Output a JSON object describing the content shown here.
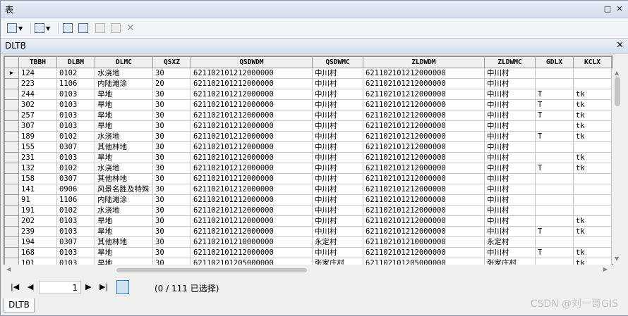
{
  "window": {
    "title": "表"
  },
  "table_name": "DLTB",
  "columns": [
    "TBBH",
    "DLBM",
    "DLMC",
    "QSXZ",
    "QSDWDM",
    "QSDWMC",
    "ZLDWDM",
    "ZLDWMC",
    "GDLX",
    "KCLX"
  ],
  "rows": [
    [
      "124",
      "0102",
      "水浇地",
      "30",
      "621102101212000000",
      "中川村",
      "621102101212000000",
      "中川村",
      "",
      ""
    ],
    [
      "223",
      "1106",
      "内陆滩涂",
      "20",
      "621102101212000000",
      "中川村",
      "621102101212000000",
      "中川村",
      "",
      ""
    ],
    [
      "244",
      "0103",
      "旱地",
      "30",
      "621102101212000000",
      "中川村",
      "621102101212000000",
      "中川村",
      "T",
      "tk"
    ],
    [
      "302",
      "0103",
      "旱地",
      "30",
      "621102101212000000",
      "中川村",
      "621102101212000000",
      "中川村",
      "T",
      "tk"
    ],
    [
      "257",
      "0103",
      "旱地",
      "30",
      "621102101212000000",
      "中川村",
      "621102101212000000",
      "中川村",
      "T",
      "tk"
    ],
    [
      "307",
      "0103",
      "旱地",
      "30",
      "621102101212000000",
      "中川村",
      "621102101212000000",
      "中川村",
      "",
      "tk"
    ],
    [
      "189",
      "0102",
      "水浇地",
      "30",
      "621102101212000000",
      "中川村",
      "621102101212000000",
      "中川村",
      "T",
      "tk"
    ],
    [
      "155",
      "0307",
      "其他林地",
      "30",
      "621102101212000000",
      "中川村",
      "621102101212000000",
      "中川村",
      "",
      ""
    ],
    [
      "231",
      "0103",
      "旱地",
      "30",
      "621102101212000000",
      "中川村",
      "621102101212000000",
      "中川村",
      "",
      "tk"
    ],
    [
      "132",
      "0102",
      "水浇地",
      "30",
      "621102101212000000",
      "中川村",
      "621102101212000000",
      "中川村",
      "T",
      "tk"
    ],
    [
      "158",
      "0307",
      "其他林地",
      "30",
      "621102101212000000",
      "中川村",
      "621102101212000000",
      "中川村",
      "",
      ""
    ],
    [
      "141",
      "0906",
      "风景名胜及特殊",
      "30",
      "621102101212000000",
      "中川村",
      "621102101212000000",
      "中川村",
      "",
      ""
    ],
    [
      "91",
      "1106",
      "内陆滩涂",
      "30",
      "621102101212000000",
      "中川村",
      "621102101212000000",
      "中川村",
      "",
      ""
    ],
    [
      "191",
      "0102",
      "水浇地",
      "30",
      "621102101212000000",
      "中川村",
      "621102101212000000",
      "中川村",
      "",
      ""
    ],
    [
      "202",
      "0103",
      "旱地",
      "30",
      "621102101212000000",
      "中川村",
      "621102101212000000",
      "中川村",
      "",
      "tk"
    ],
    [
      "239",
      "0103",
      "旱地",
      "30",
      "621102101212000000",
      "中川村",
      "621102101212000000",
      "中川村",
      "T",
      "tk"
    ],
    [
      "194",
      "0307",
      "其他林地",
      "30",
      "621102101210000000",
      "永定村",
      "621102101210000000",
      "永定村",
      "",
      ""
    ],
    [
      "168",
      "0103",
      "旱地",
      "30",
      "621102101212000000",
      "中川村",
      "621102101212000000",
      "中川村",
      "T",
      "tk"
    ],
    [
      "101",
      "0103",
      "旱地",
      "30",
      "621102101205000000",
      "张家庄村",
      "621102101205000000",
      "张家庄村",
      "",
      "tk"
    ]
  ],
  "nav": {
    "current_page": "1",
    "view_all_icon": "show-all-records-icon",
    "view_selected_icon": "show-selected-records-icon"
  },
  "status": "(0 / 111 已选择)",
  "bottom_tab": "DLTB",
  "watermark": "CSDN @刘一哥GIS"
}
